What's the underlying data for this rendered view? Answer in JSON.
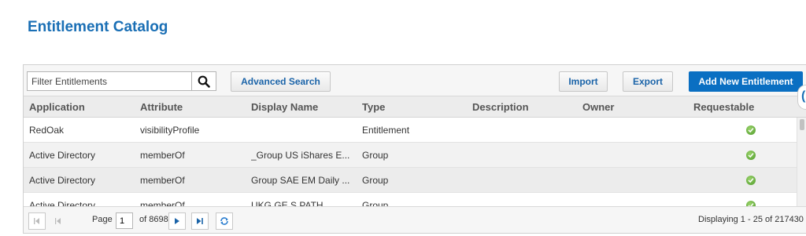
{
  "page": {
    "title": "Entitlement Catalog"
  },
  "toolbar": {
    "filter_placeholder": "Filter Entitlements",
    "advanced_search_label": "Advanced Search",
    "import_label": "Import",
    "export_label": "Export",
    "add_new_label": "Add New Entitlement"
  },
  "table": {
    "columns": [
      "Application",
      "Attribute",
      "Display Name",
      "Type",
      "Description",
      "Owner",
      "Requestable"
    ],
    "rows": [
      {
        "application": "RedOak",
        "attribute": "visibilityProfile",
        "display_name": "",
        "type": "Entitlement",
        "description": "",
        "owner": "",
        "requestable": true
      },
      {
        "application": "Active Directory",
        "attribute": "memberOf",
        "display_name": "_Group US iShares E...",
        "type": "Group",
        "description": "",
        "owner": "",
        "requestable": true
      },
      {
        "application": "Active Directory",
        "attribute": "memberOf",
        "display_name": "Group SAE EM Daily ...",
        "type": "Group",
        "description": "",
        "owner": "",
        "requestable": true
      },
      {
        "application": "Active Directory",
        "attribute": "memberOf",
        "display_name": "UKG GE S PATH ...",
        "type": "Group",
        "description": "",
        "owner": "",
        "requestable": true
      }
    ]
  },
  "pager": {
    "page_label": "Page",
    "current_page": "1",
    "of_pages": "of 8698",
    "displaying": "Displaying 1 - 25 of 217430"
  },
  "colors": {
    "accent": "#0a6fc2",
    "title": "#1a6fb5",
    "check": "#4e9a2a"
  }
}
